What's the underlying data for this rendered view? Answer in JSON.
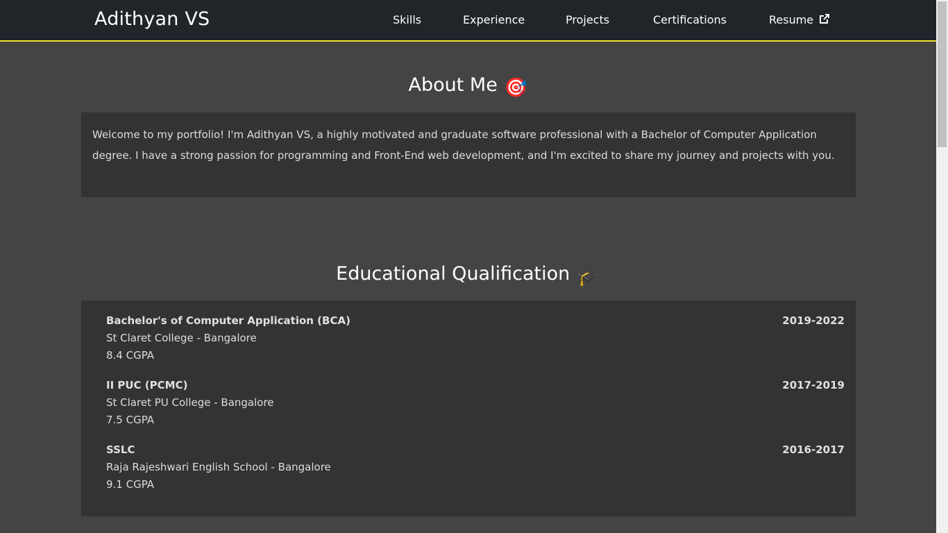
{
  "navbar": {
    "brand": "Adithyan VS",
    "links": [
      "Skills",
      "Experience",
      "Projects",
      "Certifications"
    ],
    "resume_label": "Resume",
    "accent_color": "#f5e32b"
  },
  "about": {
    "title": "About Me",
    "emoji": "🎯",
    "text": "Welcome to my portfolio! I'm Adithyan VS, a highly motivated and graduate software professional with a Bachelor of Computer Application degree. I have a strong passion for programming and Front-End web development, and I'm excited to share my journey and projects with you."
  },
  "education": {
    "title": "Educational Qualification",
    "emoji": "🎓",
    "items": [
      {
        "degree": "Bachelor's of Computer Application (BCA)",
        "school": "St Claret College - Bangalore",
        "gpa": "8.4 CGPA",
        "years": "2019-2022"
      },
      {
        "degree": "II PUC (PCMC)",
        "school": "St Claret PU College - Bangalore",
        "gpa": "7.5 CGPA",
        "years": "2017-2019"
      },
      {
        "degree": "SSLC",
        "school": "Raja Rajeshwari English School - Bangalore",
        "gpa": "9.1 CGPA",
        "years": "2016-2017"
      }
    ]
  }
}
